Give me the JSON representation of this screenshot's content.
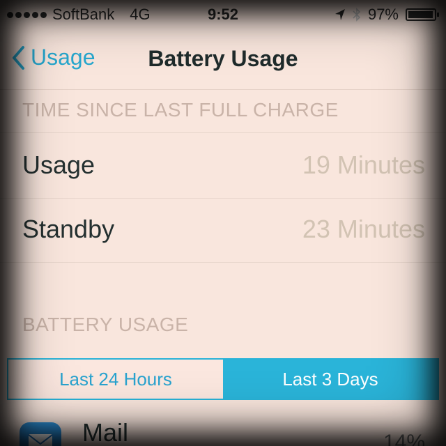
{
  "status_bar": {
    "carrier": "SoftBank",
    "network": "4G",
    "time": "9:52",
    "battery_percent": "97%",
    "battery_level": 0.97
  },
  "nav": {
    "back_label": "Usage",
    "title": "Battery Usage"
  },
  "sections": {
    "time_since_header": "TIME SINCE LAST FULL CHARGE",
    "battery_usage_header": "BATTERY USAGE"
  },
  "rows": [
    {
      "label": "Usage",
      "value": "19 Minutes"
    },
    {
      "label": "Standby",
      "value": "23 Minutes"
    }
  ],
  "segmented": {
    "option_a": "Last 24 Hours",
    "option_b": "Last 3 Days",
    "selected": "option_b"
  },
  "apps": [
    {
      "name": "Mail",
      "percent": "14%"
    }
  ],
  "colors": {
    "accent": "#2ab4d9",
    "background": "#f9e6dd"
  }
}
